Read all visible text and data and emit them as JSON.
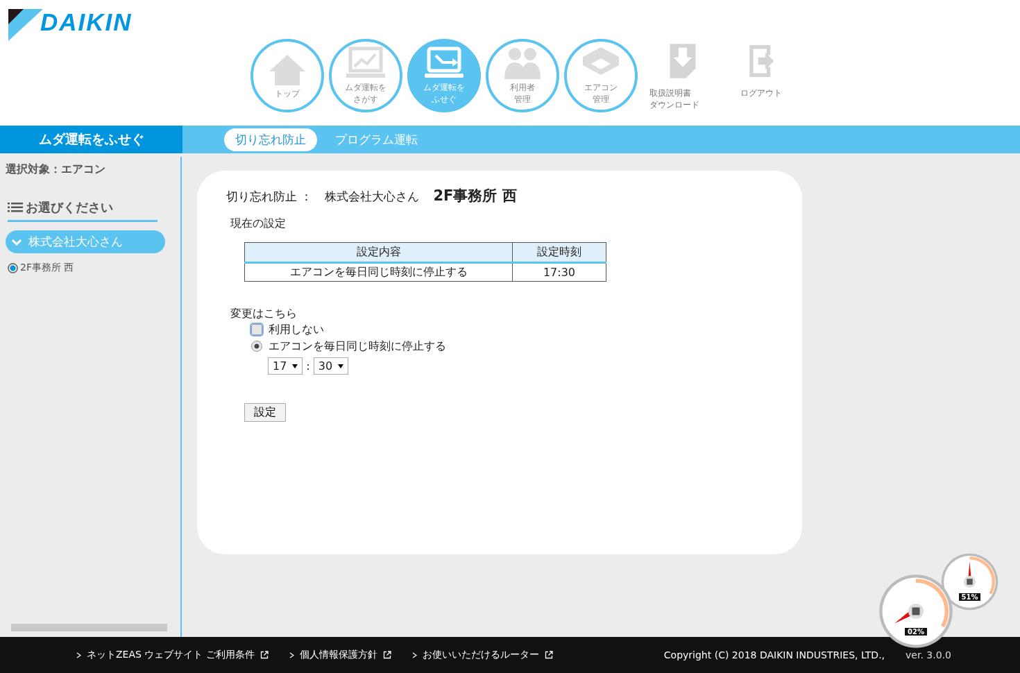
{
  "logo": "DAIKIN",
  "nav": [
    {
      "kind": "home",
      "lines": [
        "トップ"
      ],
      "selected": false
    },
    {
      "kind": "chart",
      "lines": [
        "ムダ運転を",
        "さがす"
      ],
      "selected": false
    },
    {
      "kind": "laptop",
      "lines": [
        "ムダ運転を",
        "ふせぐ"
      ],
      "selected": true
    },
    {
      "kind": "users",
      "lines": [
        "利用者",
        "管理"
      ],
      "selected": false
    },
    {
      "kind": "aircon",
      "lines": [
        "エアコン",
        "管理"
      ],
      "selected": false
    }
  ],
  "utility_links": [
    {
      "kind": "download",
      "lines": [
        "取扱説明書",
        "ダウンロード"
      ]
    },
    {
      "kind": "logout",
      "lines": [
        "ログアウト"
      ]
    }
  ],
  "section_title": "ムダ運転をふせぐ",
  "subtabs": [
    {
      "label": "切り忘れ防止",
      "selected": true
    },
    {
      "label": "プログラム運転",
      "selected": false
    }
  ],
  "sidebar": {
    "target": "選択対象：エアコン",
    "heading": "お選びください",
    "group": {
      "label": "株式会社大心さん",
      "expanded": true,
      "children": [
        {
          "label": "2F事務所 西",
          "selected": true
        }
      ]
    }
  },
  "main": {
    "title": "切り忘れ防止 ：",
    "company": "株式会社大心さん",
    "location": "2F事務所 西",
    "current_label": "現在の設定",
    "table": {
      "columns": [
        "設定内容",
        "設定時刻"
      ],
      "rows": [
        [
          "エアコンを毎日同じ時刻に停止する",
          "17:30"
        ]
      ]
    },
    "change_label": "変更はこちら",
    "options": [
      {
        "label": "利用しない",
        "selected": false
      },
      {
        "label": "エアコンを毎日同じ時刻に停止する",
        "selected": true
      }
    ],
    "hour": "17",
    "separator": ":",
    "minute": "30",
    "submit": "設定"
  },
  "footer": {
    "links": [
      "ネットZEAS ウェブサイト ご利用条件",
      "個人情報保護方針",
      "お使いいただけるルーター"
    ],
    "copyright": "Copyright (C) 2018 DAIKIN INDUSTRIES, LTD.,",
    "version": "ver. 3.0.0"
  },
  "gauges": [
    {
      "reading": "02%"
    },
    {
      "reading": "51%"
    }
  ]
}
